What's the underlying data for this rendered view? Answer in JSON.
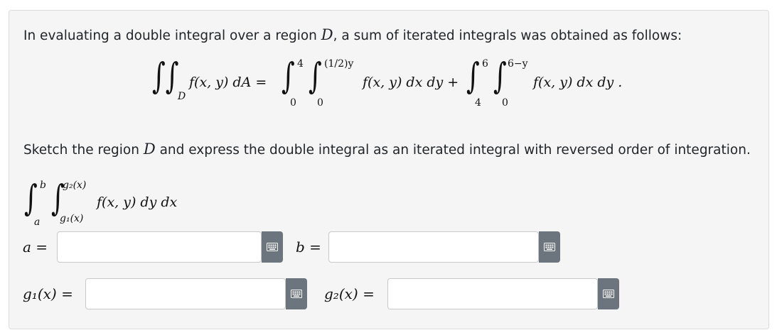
{
  "intro": {
    "before": "In evaluating a double integral over a region ",
    "region": "D",
    "after": ", a sum of iterated integrals was obtained as follows:"
  },
  "equation": {
    "lhs_sub": "D",
    "lhs_integrand": "f(x, y) dA =",
    "first": {
      "outer_upper": "4",
      "outer_lower": "0",
      "inner_upper": "(1/2)y",
      "inner_lower": "0",
      "integrand": "f(x, y) dx dy +"
    },
    "second": {
      "outer_upper": "6",
      "outer_lower": "4",
      "inner_upper": "6−y",
      "inner_lower": "0",
      "integrand": "f(x, y) dx dy ."
    }
  },
  "task": {
    "before": "Sketch the region ",
    "region": "D",
    "after": " and express the double integral as an iterated integral with reversed order of integration."
  },
  "answer_template": {
    "outer_upper": "b",
    "outer_lower": "a",
    "inner_upper": "g₂(x)",
    "inner_lower": "g₁(x)",
    "integrand": "f(x, y) dy dx"
  },
  "fields": {
    "a_label": "a =",
    "b_label": "b =",
    "g1_label": "g₁(x) =",
    "g2_label": "g₂(x) ="
  },
  "icons": {
    "keyboard": "keyboard-icon"
  },
  "colors": {
    "button": "#6c757d",
    "card": "#f5f5f5"
  }
}
